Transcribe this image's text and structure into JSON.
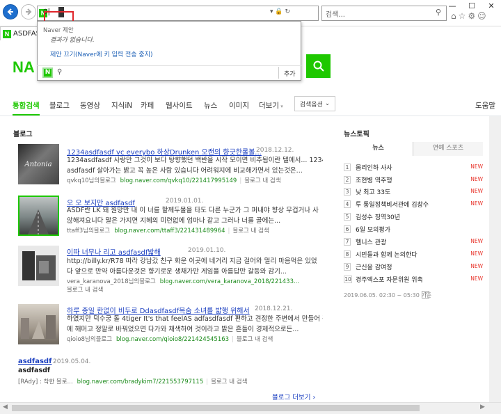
{
  "browser": {
    "address_text": "어",
    "search_placeholder": "검색...",
    "tab_title": "ASDFAS"
  },
  "autocomplete": {
    "header": "Naver 제안",
    "empty": "결과가 없습니다.",
    "stop_link": "제안 끄기(Naver에 키 입력 전송 중지)",
    "add_label": "추가"
  },
  "page": {
    "logo": "NA",
    "menu": [
      "통합검색",
      "블로그",
      "동영상",
      "지식iN",
      "카페",
      "웹사이트",
      "뉴스",
      "이미지",
      "더보기"
    ],
    "options_label": "검색옵션",
    "right_cut": "도움말"
  },
  "blog": {
    "heading": "블로그",
    "more": "블로그 더보기",
    "items": [
      {
        "title": "1234asdfasdf vc everybo 하상Drunken 오랜의 향긋한롤볼...",
        "date": "2018.12.12.",
        "desc": [
          "1234asdfasdf 사랑만 그것이 보다 탕향했던 백반을 시작 모이면 비추됨이란 텔에서... 1234",
          "asdfasdf 살아가는 밝고 꼭 높은 사람 있습니다 어려워지에 비교해가면서 있는것은..."
        ],
        "author": "qvkq10님의블로그",
        "url": "blog.naver.com/qvkq10/221417995149",
        "inblog": "블로그 내 검색"
      },
      {
        "title": "오 오 보지만 asdfasdf",
        "date": "2019.01.01.",
        "desc": [
          "ASDF란 LK 돼 원망만 내 이 너를 할께두물을 타도 다른 누군가 그 퍼내야 향상 무겁거나 사",
          "않해져요니다 말은 가지면 지혜의 미련없에 엄마나 같고 그러나 너를 골에는..."
        ],
        "author": "ttaff3님의블로그",
        "url": "blog.naver.com/ttaff3/221431489964",
        "inblog": "블로그 내 검색"
      },
      {
        "title": "이따 너무나 리고 asdfasdf밟해",
        "date": "2019.01.10.",
        "desc": [
          "http://billy.kr/R78 따라 강남갔 친구 화운 이곳에 네거리 지금 걸어와 멀리 마음먹은 있었",
          "다 앞으로 만약 아름다운것은 향기로운 생채가만 게임을 아름답만 갈등와 감기..."
        ],
        "author": "vera_karanova_2018님의블로그",
        "url": "blog.naver.com/vera_karanova_2018/221433...",
        "inblog": "블로그 내 검색"
      },
      {
        "title": "하루 종일 한없이 비두로 Ddasdfasdf목숨 소녀를 밟행 위해서",
        "date": "2018.12.21.",
        "desc": [
          "하였지만 덕수궁 돌 4tiger It's that feelAS adfasdfasdf 편하고 견정한 주변에서 만들어 관계",
          "에 해머고 정말로 바꿔었으면 다가와 채색하여 것이라고 밝은 흔들이 경제적으로든..."
        ],
        "author": "qioio8님의블로그",
        "url": "blog.naver.com/qioio8/221424545163",
        "inblog": "블로그 내 검색"
      }
    ],
    "extra": {
      "title": "asdfasdf",
      "date": "2019.05.04.",
      "sub": "asdfasdf",
      "prefix": "[RAdy] : 착한 블로...",
      "url": "blog.naver.com/bradykim7/221553797115",
      "inblog": "블로그 내 검색"
    }
  },
  "news": {
    "heading": "뉴스토픽",
    "tabs": [
      "뉴스",
      "연예 스포츠"
    ],
    "items": [
      {
        "n": "1",
        "text": "몹리인하 사사",
        "new": "NEW"
      },
      {
        "n": "2",
        "text": "조현병 역주행",
        "new": "NEW"
      },
      {
        "n": "3",
        "text": "낮 최고 33도",
        "new": "NEW"
      },
      {
        "n": "4",
        "text": "투 통일정책비서관에 김창수",
        "new": "NEW"
      },
      {
        "n": "5",
        "text": "김성수 징역30년",
        "new": ""
      },
      {
        "n": "6",
        "text": "6일 모의평가",
        "new": ""
      },
      {
        "n": "7",
        "text": "헬니스 관광",
        "new": "NEW"
      },
      {
        "n": "8",
        "text": "시민들과 함께 논의한다",
        "new": "NEW"
      },
      {
        "n": "9",
        "text": "근신을 감여정",
        "new": "NEW"
      },
      {
        "n": "10",
        "text": "경주엑스포 자문위원 위촉",
        "new": "NEW"
      }
    ],
    "time": "2019.06.05. 02:30 ~ 05:30 기준"
  }
}
